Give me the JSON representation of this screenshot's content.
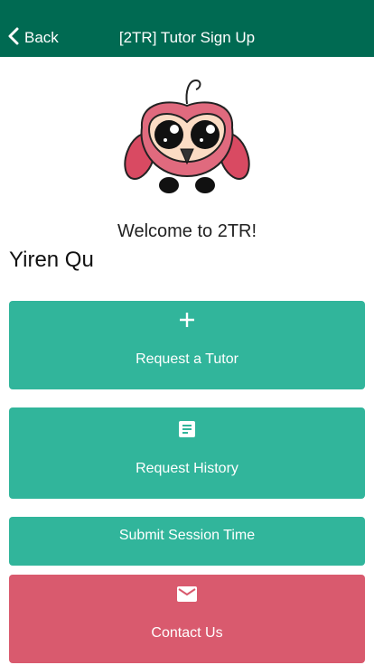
{
  "header": {
    "back_label": "Back",
    "title": "[2TR] Tutor Sign Up",
    "background": "#006a52"
  },
  "welcome_text": "Welcome to 2TR!",
  "user_name": "Yiren Qu",
  "actions": [
    {
      "label": "Request a Tutor",
      "icon": "plus-icon",
      "color": "#31b59b"
    },
    {
      "label": "Request History",
      "icon": "document-icon",
      "color": "#31b59b"
    },
    {
      "label": "Submit Session Time",
      "icon": "",
      "color": "#31b59b"
    },
    {
      "label": "Contact Us",
      "icon": "mail-icon",
      "color": "#d95a6e"
    }
  ]
}
